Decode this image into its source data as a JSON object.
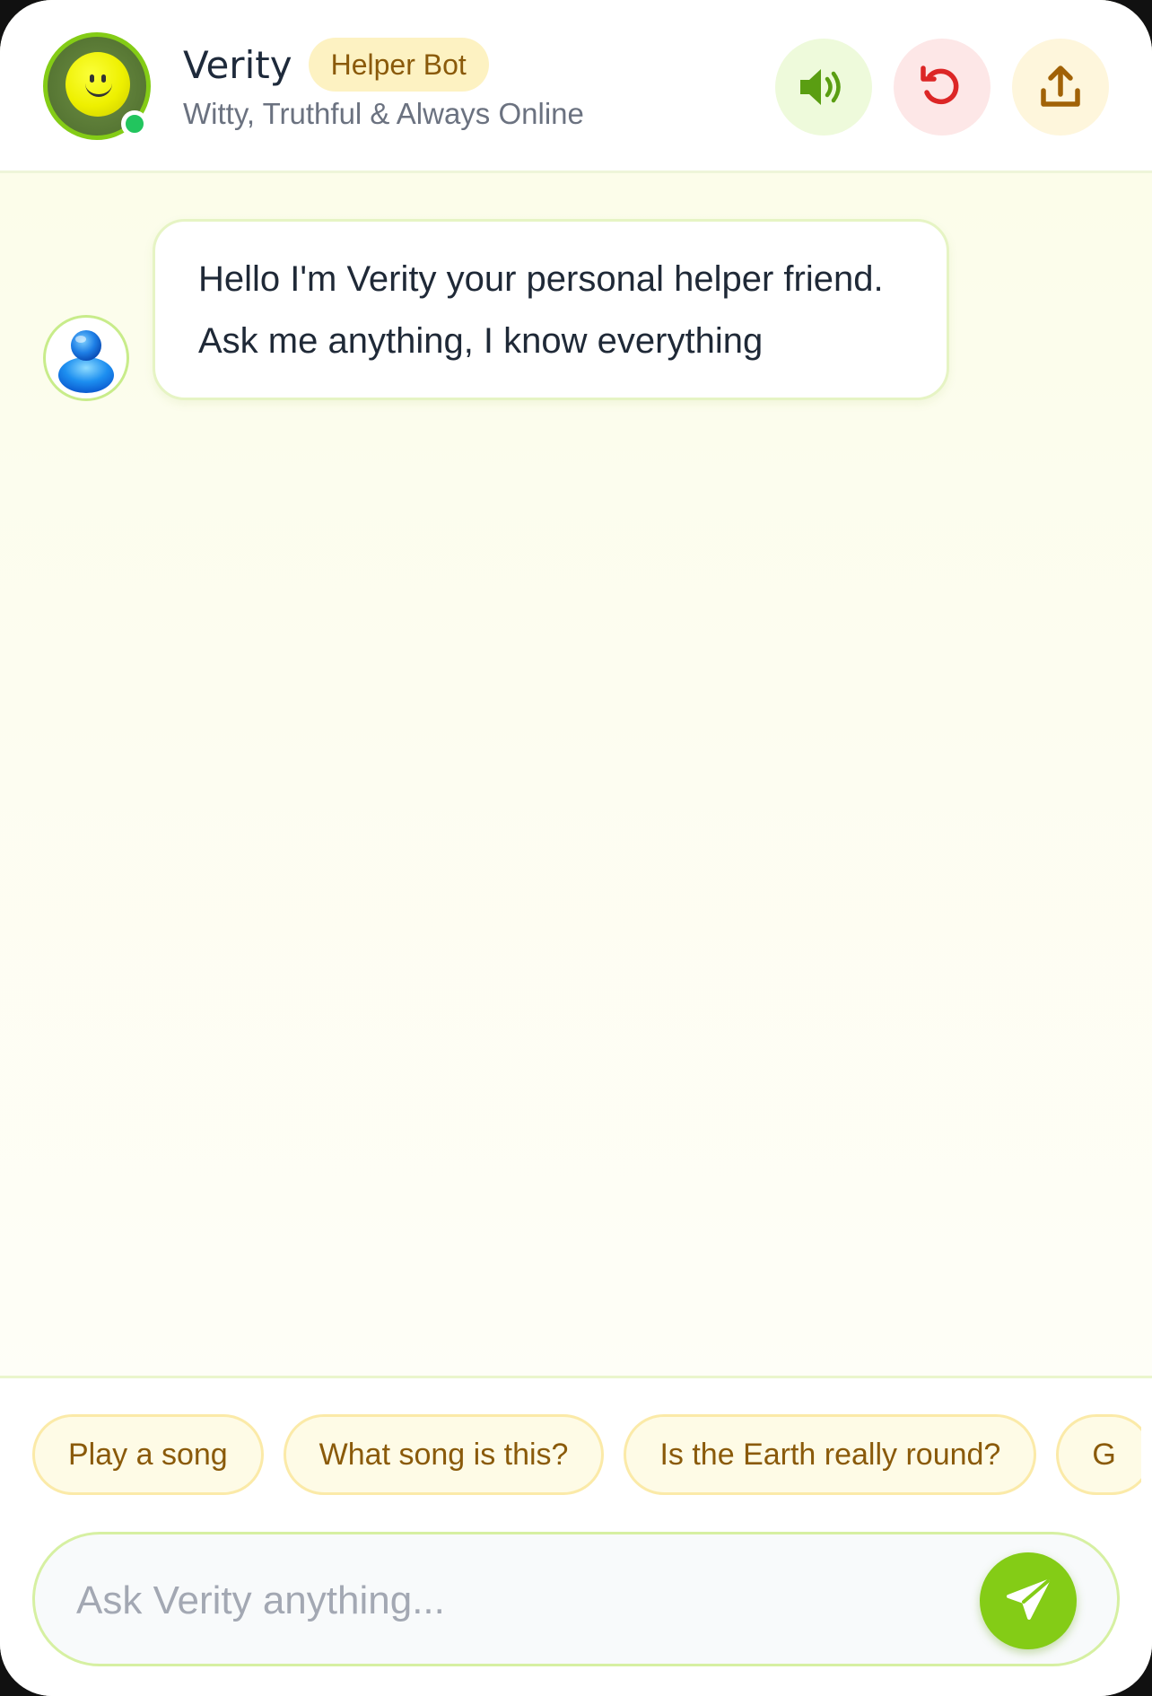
{
  "header": {
    "bot_name": "Verity",
    "badge": "Helper Bot",
    "tagline": "Witty, Truthful & Always Online",
    "status": "online"
  },
  "messages": [
    {
      "sender": "bot",
      "text": "Hello I'm Verity your personal helper friend. Ask me anything, I know everything"
    }
  ],
  "suggestions": [
    "Play a song",
    "What song is this?",
    "Is the Earth really round?",
    "G"
  ],
  "composer": {
    "placeholder": "Ask Verity anything..."
  },
  "icons": {
    "sound": "speaker-icon",
    "reset": "reset-icon",
    "share": "share-icon",
    "send": "send-icon"
  },
  "colors": {
    "accent_green": "#84cc16",
    "badge_bg": "#fdf2c2",
    "badge_text": "#8a5a0a",
    "online": "#22c55e",
    "reset_red": "#dc2626"
  }
}
